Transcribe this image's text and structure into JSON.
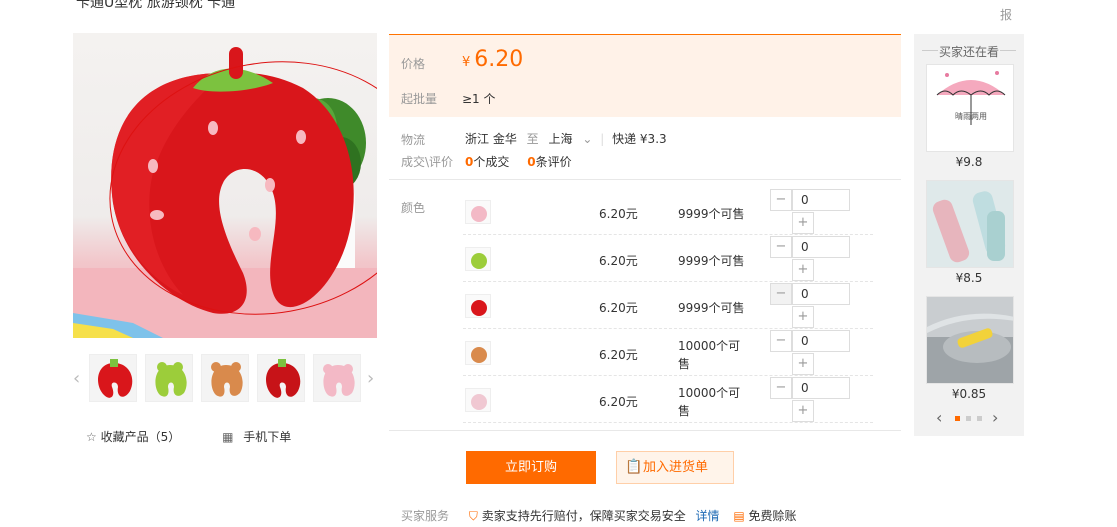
{
  "header": {
    "title_fragment": "卡通U型枕 旅游颈枕 卡通",
    "right_fragment": "",
    "report": "报"
  },
  "gallery": {
    "left_arrow": "‹",
    "right_arrow": "›",
    "thumb_count": 5
  },
  "actions": {
    "favorite_label": "收藏产品（5）",
    "mobile_label": "手机下单"
  },
  "price_block": {
    "price_label": "价格",
    "currency": "¥",
    "price": "6.20",
    "moq_label": "起批量",
    "moq_value": "≥1 个"
  },
  "logistics": {
    "label": "物流",
    "from": "浙江 金华",
    "to_word": "至",
    "to": "上海",
    "shipping": "快递 ¥3.3"
  },
  "deals": {
    "label": "成交\\评价",
    "deal_count": "0",
    "deal_text": "个成交",
    "review_count": "0",
    "review_text": "条评价"
  },
  "sku": {
    "label": "颜色",
    "rows": [
      {
        "price": "6.20元",
        "stock": "9999个可售",
        "qty": "0",
        "minus": "−",
        "plus": "+"
      },
      {
        "price": "6.20元",
        "stock": "9999个可售",
        "qty": "0",
        "minus": "−",
        "plus": "+"
      },
      {
        "price": "6.20元",
        "stock": "9999个可售",
        "qty": "0",
        "minus": "−",
        "plus": "+"
      },
      {
        "price": "6.20元",
        "stock": "10000个可售",
        "qty": "0",
        "minus": "−",
        "plus": "+"
      },
      {
        "price": "6.20元",
        "stock": "10000个可售",
        "qty": "0",
        "minus": "−",
        "plus": "+"
      }
    ]
  },
  "buttons": {
    "buy_now": "立即订购",
    "add_to_list": "加入进货单"
  },
  "service": {
    "label": "买家服务",
    "guarantee": "卖家支持先行赔付，保障买家交易安全",
    "detail_link": "详情",
    "free": "免费赊账"
  },
  "rail": {
    "title": "买家还在看",
    "items": [
      {
        "price": "¥9.8",
        "caption": "晴雨两用"
      },
      {
        "price": "¥8.5"
      },
      {
        "price": "¥0.85"
      }
    ],
    "prev": "‹",
    "next": "›"
  },
  "colors": {
    "accent": "#ff6a00",
    "price_bg": "#fff2e8"
  }
}
